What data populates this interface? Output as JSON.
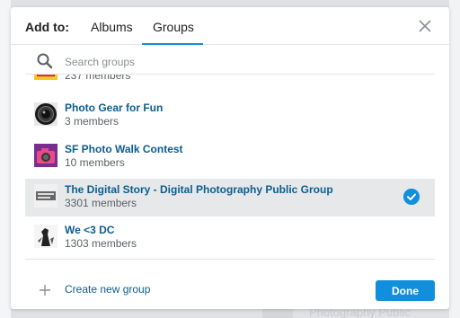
{
  "header": {
    "add_to_label": "Add to:",
    "tabs": [
      {
        "label": "Albums"
      },
      {
        "label": "Groups"
      }
    ],
    "active_tab": "Groups"
  },
  "search": {
    "placeholder": "Search groups",
    "value": ""
  },
  "groups": [
    {
      "name": "",
      "members": "237 members",
      "thumb": "kodak-logo"
    },
    {
      "name": "Photo Gear for Fun",
      "members": "3 members",
      "thumb": "camera-lens"
    },
    {
      "name": "SF Photo Walk Contest",
      "members": "10 members",
      "thumb": "camera-purple"
    },
    {
      "name": "The Digital Story - Digital Photography Public Group",
      "members": "3301 members",
      "thumb": "digital-story-logo",
      "selected": true
    },
    {
      "name": "We <3 DC",
      "members": "1303 members",
      "thumb": "bw-statue"
    }
  ],
  "footer": {
    "create_label": "Create new group",
    "done_label": "Done"
  },
  "background": {
    "text": "Photography Public"
  },
  "colors": {
    "accent": "#128fdc",
    "link": "#0b5e8f",
    "selected_row": "#e6e8ea"
  }
}
